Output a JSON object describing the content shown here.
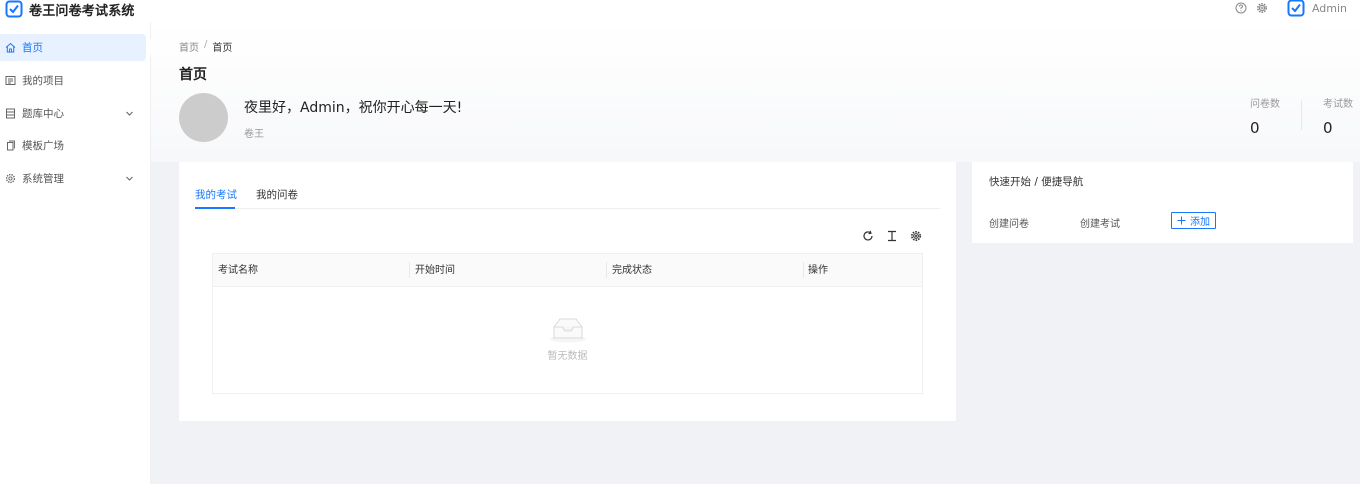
{
  "app": {
    "title": "卷王问卷考试系统"
  },
  "header": {
    "user_name": "Admin"
  },
  "sidebar": {
    "items": [
      {
        "label": "首页",
        "icon": "home-icon",
        "active": true
      },
      {
        "label": "我的项目",
        "icon": "project-icon"
      },
      {
        "label": "题库中心",
        "icon": "question-bank-icon",
        "expandable": true
      },
      {
        "label": "模板广场",
        "icon": "template-icon"
      },
      {
        "label": "系统管理",
        "icon": "gear-icon",
        "expandable": true
      }
    ]
  },
  "breadcrumb": {
    "items": [
      "首页",
      "首页"
    ],
    "separator": "/"
  },
  "page": {
    "title": "首页",
    "greeting": "夜里好，Admin，祝你开心每一天!",
    "subtitle": "卷王"
  },
  "stats": [
    {
      "label": "问卷数",
      "value": "0"
    },
    {
      "label": "考试数",
      "value": "0"
    }
  ],
  "tabs": [
    {
      "label": "我的考试",
      "active": true
    },
    {
      "label": "我的问卷"
    }
  ],
  "table": {
    "columns": [
      "考试名称",
      "开始时间",
      "完成状态",
      "操作"
    ],
    "empty_text": "暂无数据"
  },
  "quick_nav": {
    "title": "快速开始 / 便捷导航",
    "links": [
      "创建问卷",
      "创建考试"
    ],
    "add_label": "添加"
  },
  "colors": {
    "primary": "#1677ff",
    "active_bg": "#e8f1ff"
  }
}
